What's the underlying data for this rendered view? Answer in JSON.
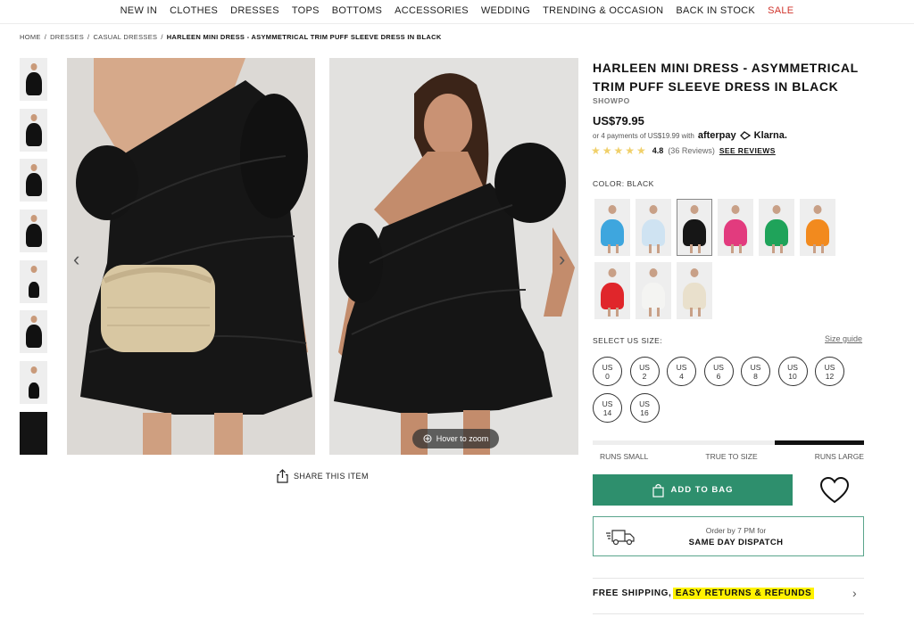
{
  "nav": {
    "items": [
      "NEW IN",
      "CLOTHES",
      "DRESSES",
      "TOPS",
      "BOTTOMS",
      "ACCESSORIES",
      "WEDDING",
      "TRENDING & OCCASION",
      "BACK IN STOCK"
    ],
    "sale": "SALE"
  },
  "breadcrumb": {
    "items": [
      "HOME",
      "/",
      "DRESSES",
      "/",
      "CASUAL DRESSES",
      "/"
    ],
    "current": "HARLEEN MINI DRESS - ASYMMETRICAL TRIM PUFF SLEEVE DRESS IN BLACK"
  },
  "gallery": {
    "hover_zoom": "Hover to zoom",
    "prev_icon": "chevron-left-icon",
    "next_icon": "chevron-right-icon",
    "thumbnail_count": 8
  },
  "share": {
    "label": "SHARE THIS ITEM"
  },
  "product": {
    "title": "HARLEEN MINI DRESS - ASYMMETRICAL TRIM PUFF SLEEVE DRESS IN BLACK",
    "brand": "SHOWPO",
    "price": "US$79.95",
    "installments": "or 4 payments of US$19.99 with",
    "afterpay": "afterpay",
    "klarna": "Klarna.",
    "rating": "4.8",
    "rating_stars": 5,
    "reviews": "(36 Reviews)",
    "see_reviews": "SEE REVIEWS"
  },
  "color": {
    "label": "COLOR: BLACK",
    "swatches": [
      {
        "name": "sky-blue",
        "hex": "#3ea6de"
      },
      {
        "name": "light-blue",
        "hex": "#cfe3f2"
      },
      {
        "name": "black",
        "hex": "#161616",
        "selected": true
      },
      {
        "name": "pink",
        "hex": "#e23b7e"
      },
      {
        "name": "green",
        "hex": "#1fa35a"
      },
      {
        "name": "orange",
        "hex": "#f28a1e"
      },
      {
        "name": "red",
        "hex": "#e0262b"
      },
      {
        "name": "white",
        "hex": "#f4f4f2"
      },
      {
        "name": "cream",
        "hex": "#e9e0cc"
      }
    ]
  },
  "size": {
    "label": "SELECT US SIZE:",
    "guide": "Size guide",
    "options": [
      {
        "us": "US",
        "n": "0"
      },
      {
        "us": "US",
        "n": "2"
      },
      {
        "us": "US",
        "n": "4"
      },
      {
        "us": "US",
        "n": "6"
      },
      {
        "us": "US",
        "n": "8"
      },
      {
        "us": "US",
        "n": "10"
      },
      {
        "us": "US",
        "n": "12"
      },
      {
        "us": "US",
        "n": "14"
      },
      {
        "us": "US",
        "n": "16"
      }
    ]
  },
  "fit": {
    "labels": [
      "RUNS SMALL",
      "TRUE TO SIZE",
      "RUNS LARGE"
    ],
    "level": 0.33
  },
  "cart": {
    "add_label": "ADD TO BAG"
  },
  "dispatch": {
    "line1": "Order by 7 PM for",
    "line2": "SAME DAY DISPATCH"
  },
  "shipping": {
    "prefix": "FREE SHIPPING,",
    "highlight": "EASY RETURNS & REFUNDS"
  },
  "colors": {
    "accent": "#2e8f6d",
    "sale": "#d0342c",
    "star": "#f0d06a",
    "highlight": "#fff200"
  }
}
